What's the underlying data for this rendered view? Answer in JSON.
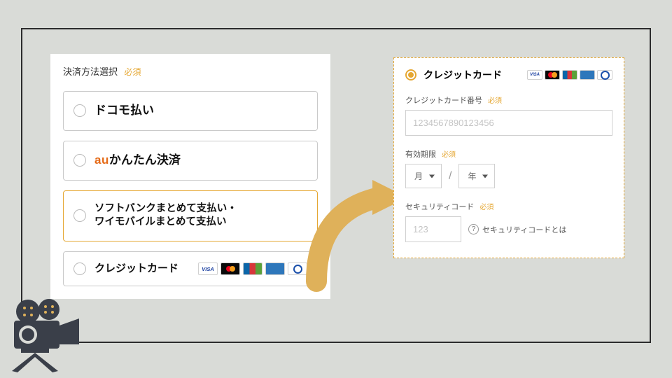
{
  "left": {
    "title": "決済方法選択",
    "required": "必須",
    "options": {
      "docomo": "ドコモ払い",
      "au_prefix": "au",
      "au_rest": "かんたん決済",
      "softbank": "ソフトバンクまとめて支払い・\nワイモバイルまとめて支払い",
      "credit": "クレジットカード"
    },
    "card_brands": [
      "VISA",
      "mastercard",
      "JCB",
      "AMEX",
      "Diners"
    ]
  },
  "right": {
    "title": "クレジットカード",
    "card_number": {
      "label": "クレジットカード番号",
      "required": "必須",
      "placeholder": "1234567890123456"
    },
    "expiry": {
      "label": "有効期限",
      "required": "必須",
      "month": "月",
      "year": "年"
    },
    "security": {
      "label": "セキュリティコード",
      "required": "必須",
      "placeholder": "123",
      "help": "セキュリティコードとは"
    }
  }
}
